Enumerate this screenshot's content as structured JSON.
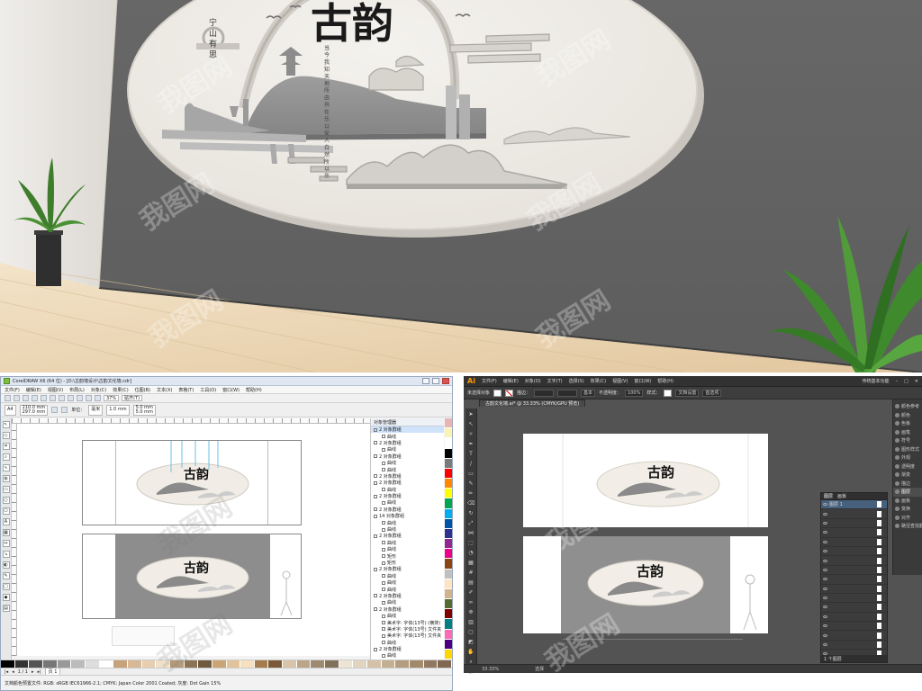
{
  "scene": {
    "artwork_title": "古韵",
    "artwork_poem_left": "宁 山 有 思",
    "artwork_poem_right": "当 今 我 知 天 地 所 由 共 在 乐 以 安 人 白 然 所 以 乐"
  },
  "watermark": {
    "text": "我图网"
  },
  "corel": {
    "title": "CorelDRAW X6 (64 位) - [D:\\古韵墙设计\\古韵文化墙.cdr]",
    "menu": [
      "文件(F)",
      "编辑(E)",
      "视图(V)",
      "布局(L)",
      "对象(C)",
      "效果(C)",
      "位图(B)",
      "文本(X)",
      "表格(T)",
      "工具(O)",
      "窗口(W)",
      "帮助(H)"
    ],
    "zoom": "37%",
    "snap_label": "贴齐(T)",
    "prop": {
      "page": "A4",
      "w": "210.0 mm",
      "h": "297.0 mm",
      "unit_label": "单位：",
      "unit": "毫米",
      "nudge": "1.0 mm",
      "dup_x": "5.0 mm",
      "dup_y": "5.0 mm"
    },
    "docker_title": "对象管理器",
    "docker_rows": [
      {
        "label": "2 对象群组",
        "lvl": 1
      },
      {
        "label": "曲线",
        "lvl": 2
      },
      {
        "label": "2 对象群组",
        "lvl": 1
      },
      {
        "label": "曲线",
        "lvl": 2
      },
      {
        "label": "2 对象群组",
        "lvl": 1
      },
      {
        "label": "曲线",
        "lvl": 2
      },
      {
        "label": "曲线",
        "lvl": 2
      },
      {
        "label": "2 对象群组",
        "lvl": 1
      },
      {
        "label": "2 对象群组",
        "lvl": 1
      },
      {
        "label": "曲线",
        "lvl": 2
      },
      {
        "label": "2 对象群组",
        "lvl": 1
      },
      {
        "label": "曲线",
        "lvl": 2
      },
      {
        "label": "2 对象群组",
        "lvl": 1
      },
      {
        "label": "14 对象群组",
        "lvl": 1
      },
      {
        "label": "曲线",
        "lvl": 2
      },
      {
        "label": "曲线",
        "lvl": 2
      },
      {
        "label": "2 对象群组",
        "lvl": 1
      },
      {
        "label": "曲线",
        "lvl": 2
      },
      {
        "label": "曲线",
        "lvl": 2
      },
      {
        "label": "矩形",
        "lvl": 2
      },
      {
        "label": "矩形",
        "lvl": 2
      },
      {
        "label": "2 对象群组",
        "lvl": 1
      },
      {
        "label": "曲线",
        "lvl": 2
      },
      {
        "label": "曲线",
        "lvl": 2
      },
      {
        "label": "曲线",
        "lvl": 2
      },
      {
        "label": "2 对象群组",
        "lvl": 1
      },
      {
        "label": "曲线",
        "lvl": 2
      },
      {
        "label": "2 对象群组",
        "lvl": 1
      },
      {
        "label": "曲线",
        "lvl": 2
      },
      {
        "label": "美术字: 字体(13号) (横排)",
        "lvl": 2
      },
      {
        "label": "美术字: 字体(13号) 文件夹",
        "lvl": 2
      },
      {
        "label": "美术字: 字体(13号) 文件夹",
        "lvl": 2
      },
      {
        "label": "曲线",
        "lvl": 2
      },
      {
        "label": "2 对象群组",
        "lvl": 1
      },
      {
        "label": "曲线",
        "lvl": 2
      },
      {
        "label": "美术字: 字体(13号) (横排)",
        "lvl": 2
      }
    ],
    "pagenav": "1 / 1",
    "page_tab": "页 1",
    "status": "文档颜色预置文件: RGB: sRGB IEC61966-2.1; CMYK: Japan Color 2001 Coated; 灰度: Dot Gain 15%",
    "palette_v": [
      "#e8b4b4",
      "#f7f4b6",
      "#ffffff",
      "#000000",
      "#7a7a7a",
      "#ff0000",
      "#ff8800",
      "#ffff00",
      "#00a650",
      "#00adef",
      "#0054a6",
      "#2e3192",
      "#92278f",
      "#ec008c",
      "#8b4513",
      "#c0c0c0",
      "#ffe4c4",
      "#d2b48c",
      "#556b2f",
      "#800000",
      "#008080",
      "#ff69b4",
      "#4b0082",
      "#ffd700"
    ],
    "palette_h": [
      "#000",
      "#333",
      "#555",
      "#777",
      "#999",
      "#bbb",
      "#ddd",
      "#fff",
      "#c8a27a",
      "#d9b995",
      "#e6cfb0",
      "#f0e0c8",
      "#b39b7a",
      "#8c7355",
      "#6f5a40",
      "#caa472",
      "#e0c39a",
      "#f5e0bf",
      "#a37b4f",
      "#7a5a36",
      "#d8c4a8",
      "#bba58a",
      "#9d8a70",
      "#82705a",
      "#ece4d6",
      "#e2d5c0",
      "#d4c2a8",
      "#c4af92",
      "#b39c80",
      "#a2896c",
      "#917860",
      "#806750"
    ]
  },
  "ai": {
    "menu": [
      "文件(F)",
      "编辑(E)",
      "对象(O)",
      "文字(T)",
      "选择(S)",
      "效果(C)",
      "视图(V)",
      "窗口(W)",
      "帮助(H)"
    ],
    "workspace": "传统基本功能",
    "ctrl": {
      "nosel": "未选择对象",
      "stroke_label": "描边：",
      "style": "基本",
      "opacity_label": "不透明度：",
      "opacity": "100%",
      "style_label": "样式：",
      "doc_setup": "文档设置",
      "prefs": "首选项"
    },
    "doc_tab": "古韵文化墙.ai* @ 33.33% (CMYK/GPU 预览)",
    "panels": [
      "颜色参考",
      "颜色",
      "色板",
      "画笔",
      "符号",
      "图形样式",
      "外观",
      "透明度",
      "渐变",
      "描边",
      "图层",
      "画板",
      "变换",
      "对齐",
      "路径查找器"
    ],
    "active_panel": "图层",
    "layers_tabs": [
      "图层",
      "画板"
    ],
    "layer_name": "图层 1",
    "layer_count": 17,
    "layers_footer": "1 个图层",
    "status_zoom": "33.33%",
    "status_tool": "选择"
  }
}
